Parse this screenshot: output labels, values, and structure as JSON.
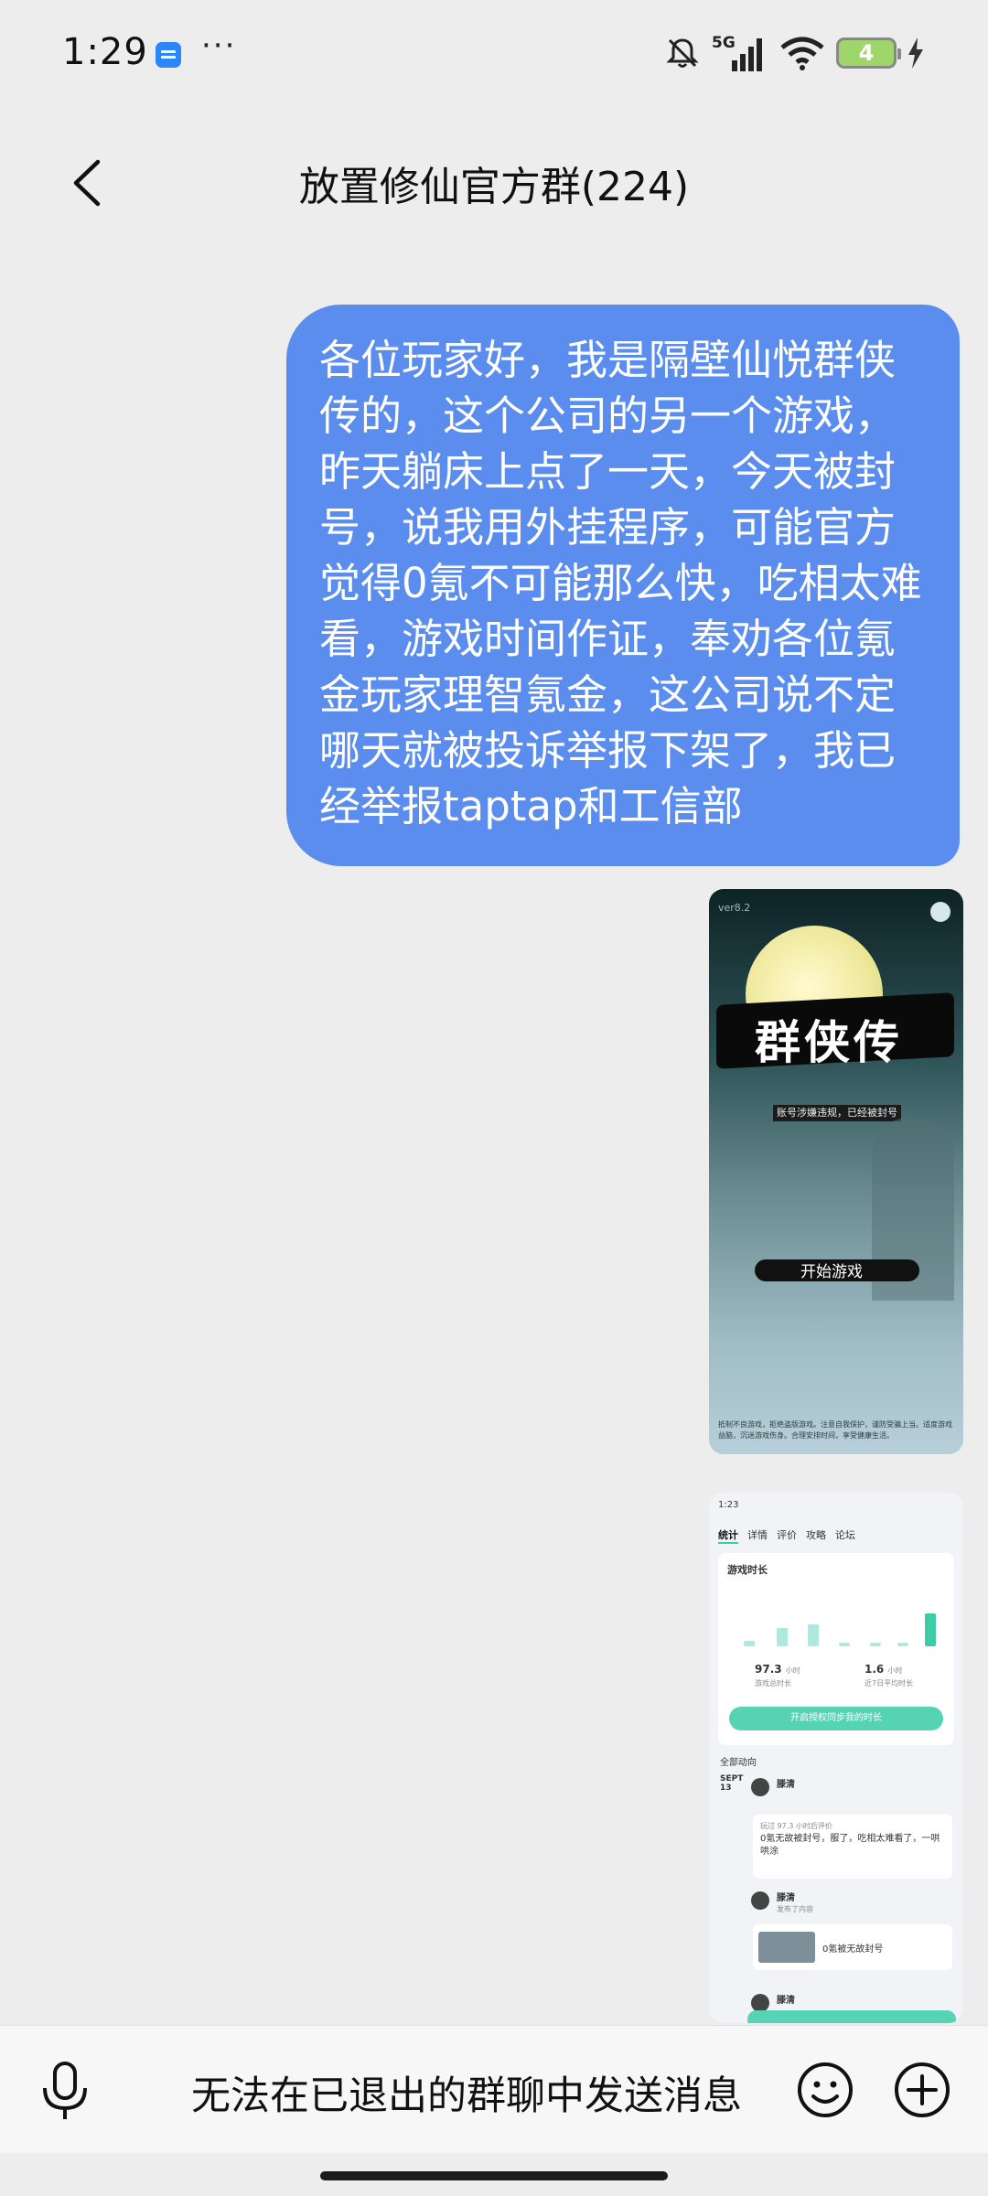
{
  "status_bar": {
    "time": "1:29",
    "more": "···",
    "network": "5G",
    "battery_level": "4"
  },
  "header": {
    "title": "放置修仙官方群(224)"
  },
  "messages": {
    "text_message": "各位玩家好，我是隔壁仙悦群侠传的，这个公司的另一个游戏，昨天躺床上点了一天，今天被封号，说我用外挂程序，可能官方觉得0氪不可能那么快，吃相太难看，游戏时间作证，奉劝各位氪金玩家理智氪金，这公司说不定哪天就被投诉举报下架了，我已经举报taptap和工信部",
    "image_game": {
      "version": "ver8.2",
      "title": "群侠传",
      "banner": "账号涉嫌违规，已经被封号",
      "start": "开始游戏",
      "footer": "抵制不良游戏，拒绝盗版游戏。注意自我保护，谨防受骗上当。适度游戏益脑，沉迷游戏伤身。合理安排时间，享受健康生活。"
    },
    "image_screenshot": {
      "status_time": "1:23",
      "tabs": [
        "统计",
        "详情",
        "评价",
        "攻略",
        "论坛"
      ],
      "card_title": "游戏时长",
      "stat_total": "97.3",
      "stat_total_unit": "小时",
      "stat_total_label": "游戏总时长",
      "stat_recent": "1.6",
      "stat_recent_unit": "小时",
      "stat_recent_label": "近7日平均时长",
      "button": "开启授权同步我的时长",
      "feed_label": "全部动向",
      "date_month": "SEPT",
      "date_day": "13",
      "user": "滕清",
      "review_meta": "玩过 97.3 小时后评价",
      "review_text": "0氪无故被封号，服了，吃相太难看了，一哄哄涂",
      "post_meta": "发布了内容",
      "post_text": "0氪被无故封号"
    }
  },
  "input_bar": {
    "hint": "无法在已退出的群聊中发送消息"
  }
}
